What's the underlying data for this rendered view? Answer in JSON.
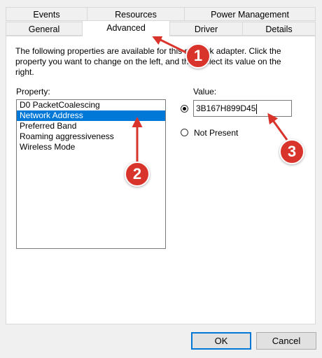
{
  "tabs_row1": [
    "Events",
    "Resources",
    "Power Management"
  ],
  "tabs_row2": [
    "General",
    "Advanced",
    "Driver",
    "Details"
  ],
  "description": "The following properties are available for this network adapter. Click the property you want to change on the left, and then select its value on the right.",
  "property_label": "Property:",
  "value_label": "Value:",
  "properties": [
    "D0 PacketCoalescing",
    "Network Address",
    "Preferred Band",
    "Roaming aggressiveness",
    "Wireless Mode"
  ],
  "selected_property": "Network Address",
  "value_input": "3B167H899D45",
  "not_present_label": "Not Present",
  "buttons": {
    "ok": "OK",
    "cancel": "Cancel"
  },
  "markers": [
    "1",
    "2",
    "3"
  ],
  "colors": {
    "marker": "#d9342b",
    "selection": "#0078d7"
  }
}
